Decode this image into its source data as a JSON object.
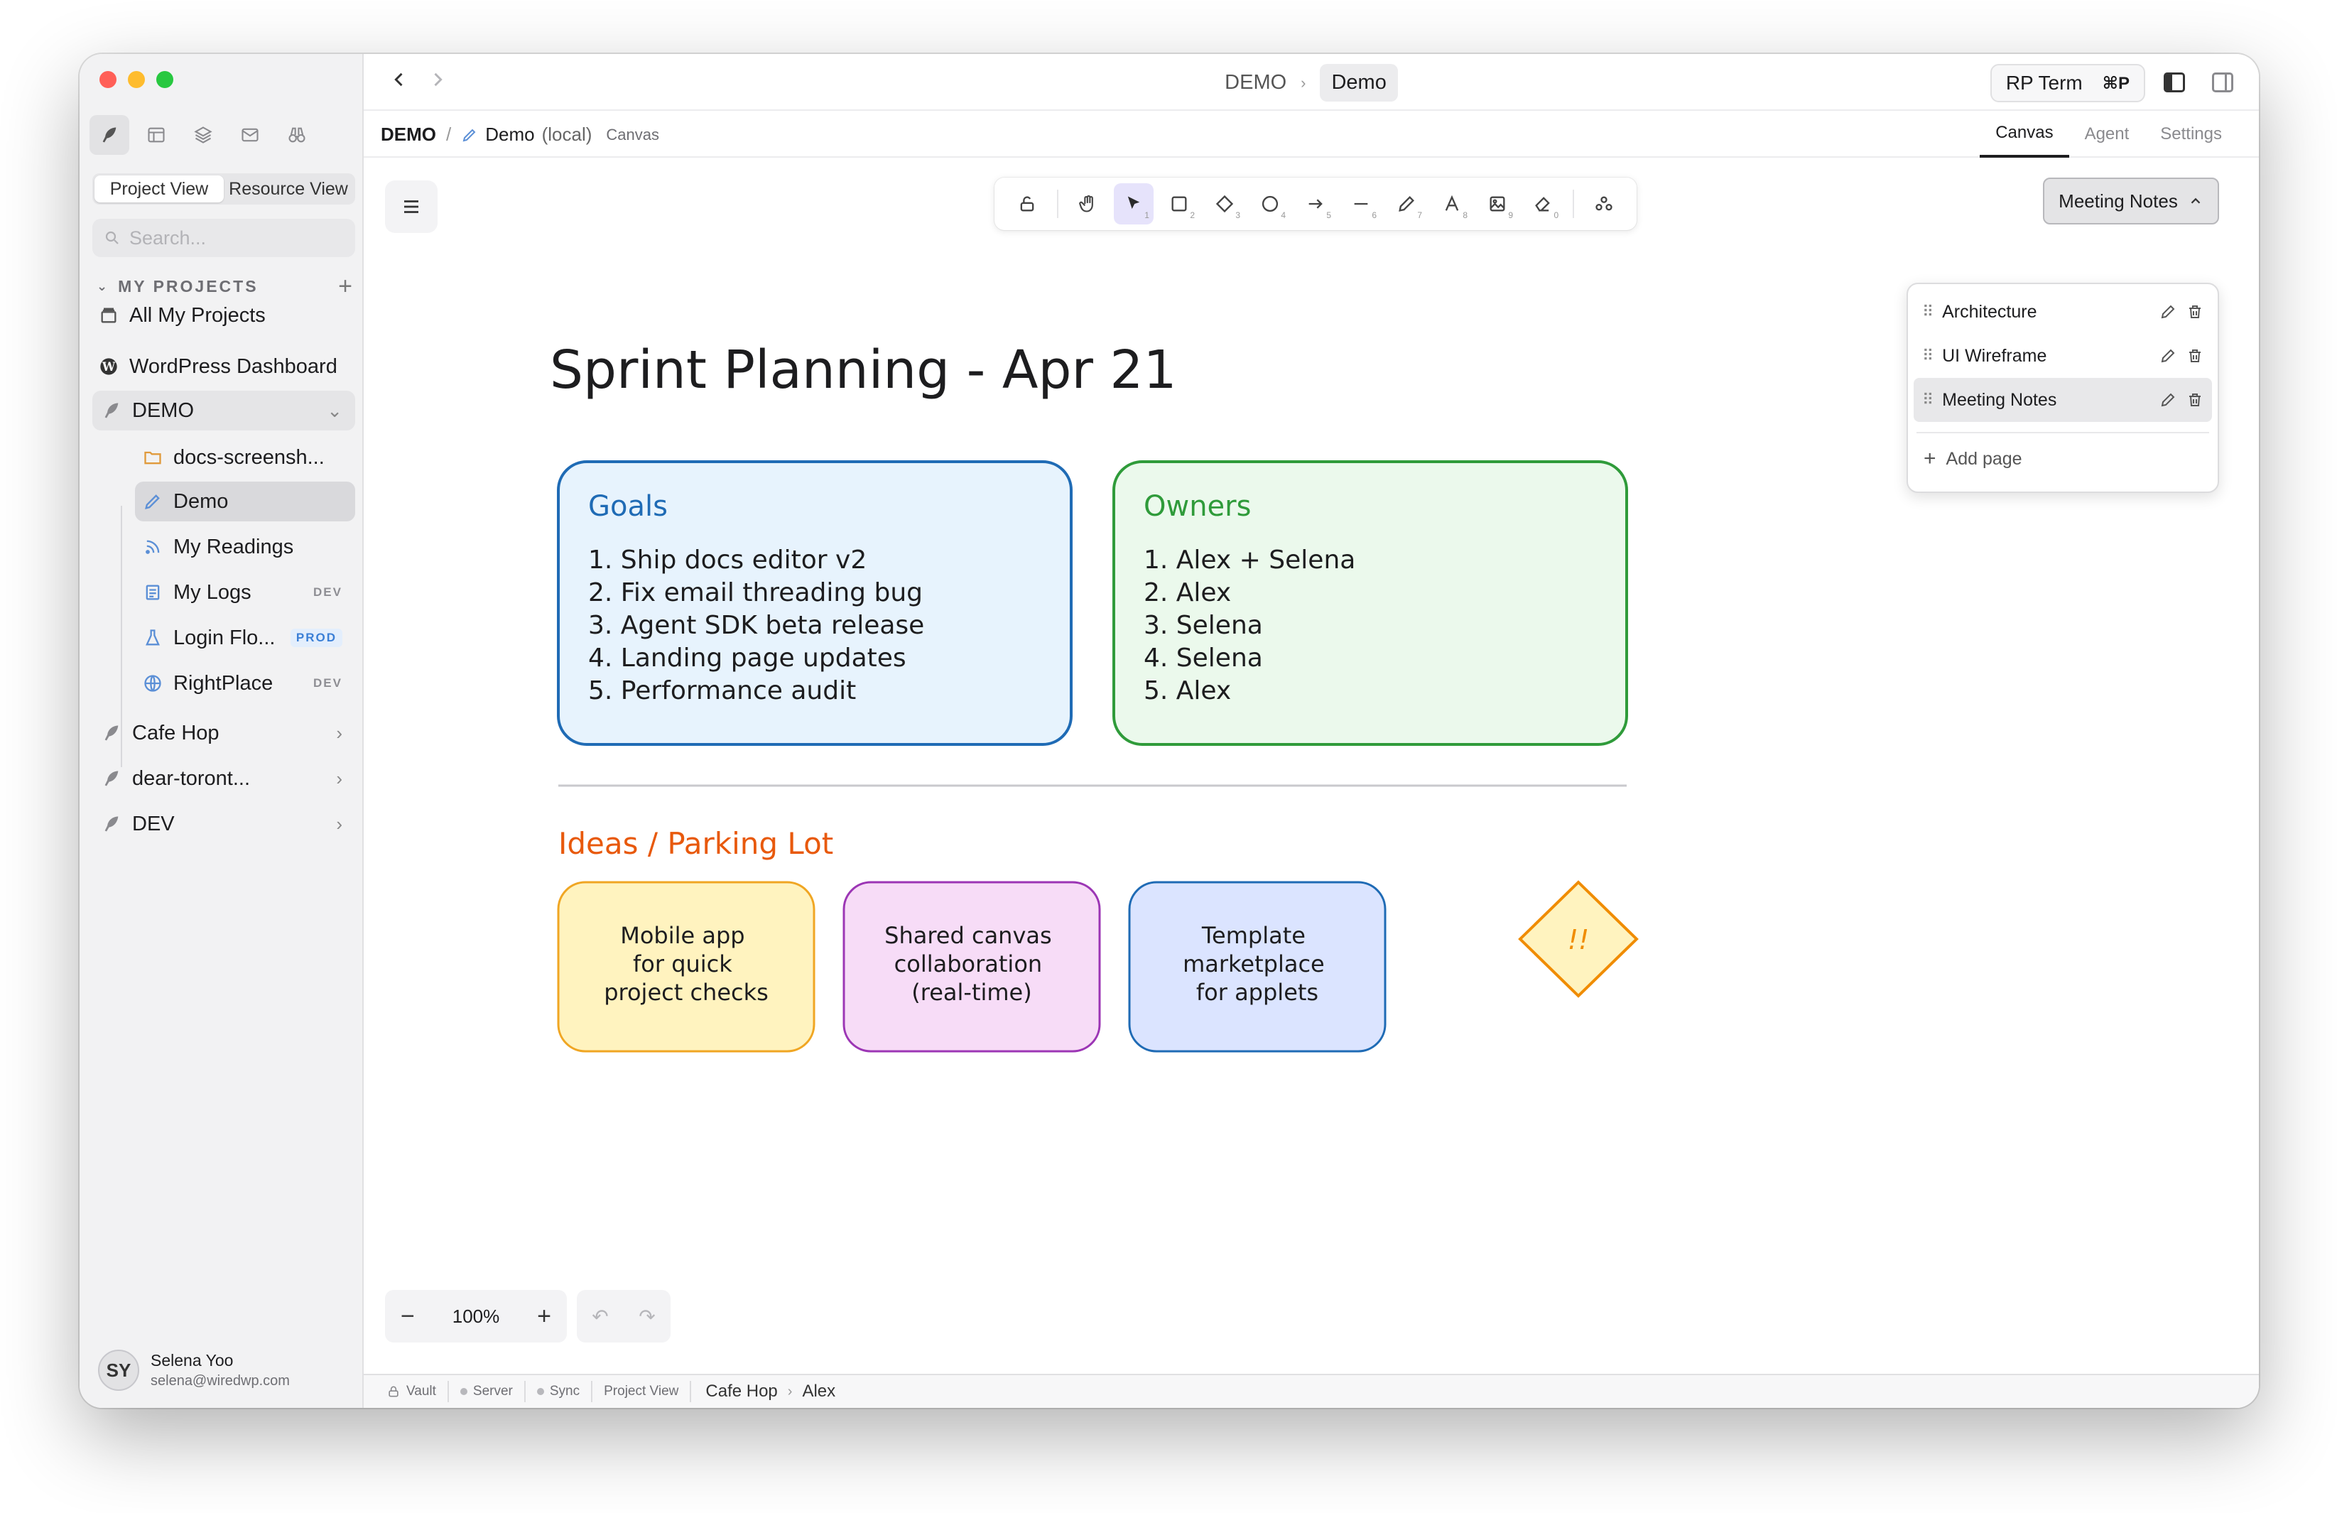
{
  "sidebar": {
    "view_toggle": [
      "Project View",
      "Resource View"
    ],
    "search_placeholder": "Search...",
    "projects_header": "MY PROJECTS",
    "items": {
      "all_projects": "All My Projects",
      "wordpress": "WordPress Dashboard",
      "demo_group": "DEMO",
      "docs": "docs-screensh...",
      "demo": "Demo",
      "readings": "My Readings",
      "logs": "My Logs",
      "logs_badge": "DEV",
      "login": "Login Flo...",
      "login_badge": "PROD",
      "rightplace": "RightPlace",
      "rightplace_badge": "DEV",
      "cafe": "Cafe Hop",
      "dear": "dear-toront...",
      "dev": "DEV"
    },
    "user": {
      "initials": "SY",
      "name": "Selena Yoo",
      "email": "selena@wiredwp.com"
    }
  },
  "titlebar": {
    "crumb_parent": "DEMO",
    "crumb_current": "Demo",
    "rpterm_label": "RP Term",
    "rpterm_shortcut": "⌘P"
  },
  "subbar": {
    "path_root": "DEMO",
    "path_name": "Demo",
    "path_local": "(local)",
    "path_type": "Canvas",
    "tabs": [
      "Canvas",
      "Agent",
      "Settings"
    ]
  },
  "toolbar": {
    "tools": [
      {
        "icon": "lock-icon",
        "key": ""
      },
      {
        "icon": "hand-icon",
        "key": ""
      },
      {
        "icon": "pointer-icon",
        "key": "1"
      },
      {
        "icon": "rectangle-icon",
        "key": "2"
      },
      {
        "icon": "diamond-icon",
        "key": "3"
      },
      {
        "icon": "ellipse-icon",
        "key": "4"
      },
      {
        "icon": "arrow-icon",
        "key": "5"
      },
      {
        "icon": "line-icon",
        "key": "6"
      },
      {
        "icon": "pencil-icon",
        "key": "7"
      },
      {
        "icon": "text-icon",
        "key": "8"
      },
      {
        "icon": "image-icon",
        "key": "9"
      },
      {
        "icon": "eraser-icon",
        "key": "0"
      },
      {
        "icon": "shapes-icon",
        "key": ""
      }
    ]
  },
  "pages": {
    "current": "Meeting Notes",
    "list": [
      "Architecture",
      "UI Wireframe",
      "Meeting Notes"
    ],
    "add_label": "Add page"
  },
  "canvas": {
    "title": "Sprint Planning - Apr 21",
    "goals": {
      "heading": "Goals",
      "items": [
        "1. Ship docs editor v2",
        "2. Fix email threading bug",
        "3. Agent SDK beta release",
        "4. Landing page updates",
        "5. Performance audit"
      ]
    },
    "owners": {
      "heading": "Owners",
      "items": [
        "1. Alex + Selena",
        "2. Alex",
        "3. Selena",
        "4. Selena",
        "5. Alex"
      ]
    },
    "ideas_heading": "Ideas / Parking Lot",
    "ideas": [
      {
        "lines": [
          "Mobile app",
          "for quick",
          "project checks"
        ]
      },
      {
        "lines": [
          "Shared canvas",
          "collaboration",
          "(real-time)"
        ]
      },
      {
        "lines": [
          "Template",
          "marketplace",
          "for applets"
        ]
      }
    ],
    "diamond_text": "!!",
    "colors": {
      "goals_stroke": "#1f6bb5",
      "goals_fill": "#e7f3fd",
      "owners_stroke": "#2f9b3a",
      "owners_fill": "#ebf9ec",
      "ideas_heading": "#e8590c",
      "idea1_stroke": "#f0a623",
      "idea1_fill": "#fff3bf",
      "idea2_stroke": "#9c36b5",
      "idea2_fill": "#f7dcf7",
      "idea3_stroke": "#1f6bb5",
      "idea3_fill": "#dbe4ff",
      "diamond_stroke": "#f08c00",
      "diamond_fill": "#fff3bf"
    }
  },
  "zoom": {
    "level": "100%"
  },
  "statusbar": {
    "vault": "Vault",
    "server": "Server",
    "sync": "Sync",
    "view": "Project View",
    "crumb": [
      "Cafe Hop",
      "Alex"
    ]
  }
}
